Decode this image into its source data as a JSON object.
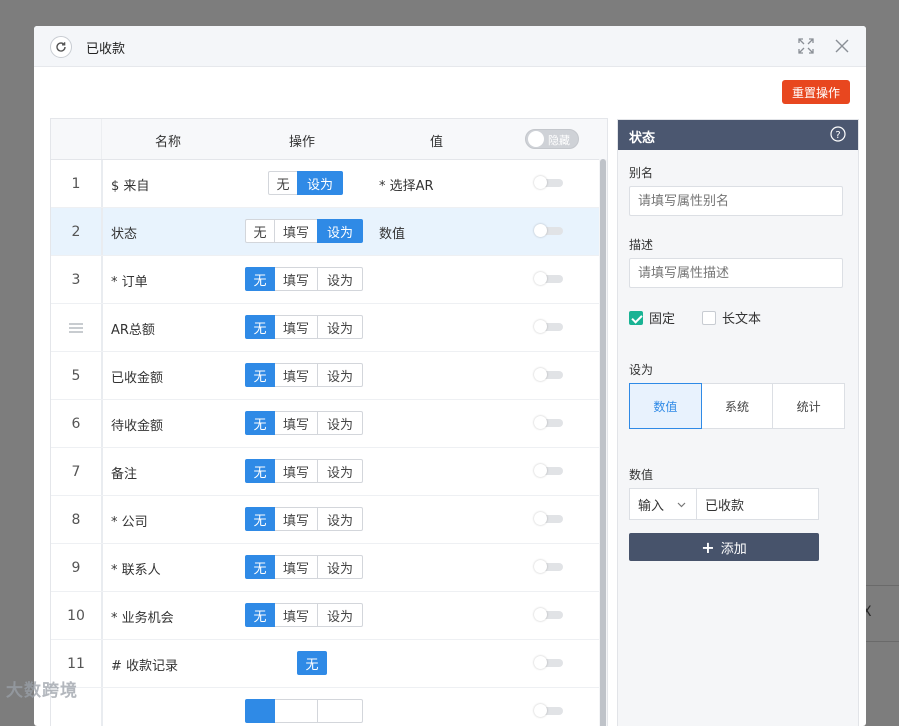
{
  "dialog": {
    "title": "已收款",
    "reset_label": "重置操作"
  },
  "table": {
    "headers": {
      "name": "名称",
      "op": "操作",
      "value": "值",
      "hide_toggle": "隐藏"
    },
    "rows": [
      {
        "index": "1",
        "name": "$ 来自",
        "options": [
          "无",
          "设为"
        ],
        "active": "设为",
        "value": "* 选择AR"
      },
      {
        "index": "2",
        "name": "状态",
        "options": [
          "无",
          "填写",
          "设为"
        ],
        "active": "设为",
        "value": "数值",
        "selected": true
      },
      {
        "index": "3",
        "name": "* 订单",
        "options": [
          "无",
          "填写",
          "设为"
        ],
        "active": "无",
        "value": ""
      },
      {
        "index": "",
        "name": "AR总额",
        "options": [
          "无",
          "填写",
          "设为"
        ],
        "active": "无",
        "value": "",
        "drag_icon": "drag-handle-icon"
      },
      {
        "index": "5",
        "name": "已收金额",
        "options": [
          "无",
          "填写",
          "设为"
        ],
        "active": "无",
        "value": ""
      },
      {
        "index": "6",
        "name": "待收金额",
        "options": [
          "无",
          "填写",
          "设为"
        ],
        "active": "无",
        "value": ""
      },
      {
        "index": "7",
        "name": "备注",
        "options": [
          "无",
          "填写",
          "设为"
        ],
        "active": "无",
        "value": ""
      },
      {
        "index": "8",
        "name": "* 公司",
        "options": [
          "无",
          "填写",
          "设为"
        ],
        "active": "无",
        "value": ""
      },
      {
        "index": "9",
        "name": "* 联系人",
        "options": [
          "无",
          "填写",
          "设为"
        ],
        "active": "无",
        "value": ""
      },
      {
        "index": "10",
        "name": "* 业务机会",
        "options": [
          "无",
          "填写",
          "设为"
        ],
        "active": "无",
        "value": ""
      },
      {
        "index": "11",
        "name": "# 收款记录",
        "options": [
          "无"
        ],
        "active": "无",
        "value": ""
      },
      {
        "index": "",
        "name": "",
        "options": [
          "",
          "",
          ""
        ],
        "active": "",
        "value": ""
      }
    ]
  },
  "panel": {
    "title": "状态",
    "alias_label": "别名",
    "alias_placeholder": "请填写属性别名",
    "desc_label": "描述",
    "desc_placeholder": "请填写属性描述",
    "fixed_label": "固定",
    "fixed_checked": true,
    "longtext_label": "长文本",
    "longtext_checked": false,
    "set_label": "设为",
    "set_options": [
      "数值",
      "系统",
      "统计"
    ],
    "set_active": "数值",
    "value_label": "数值",
    "input_mode": "输入",
    "input_value": "已收款",
    "add_label": "添加"
  },
  "background": {
    "partial_glyph": "X"
  },
  "watermark": "大数跨境",
  "colors": {
    "accent": "#2f8ae6",
    "reset": "#e8471f",
    "panel_header": "#4b5770",
    "check": "#19b394"
  }
}
